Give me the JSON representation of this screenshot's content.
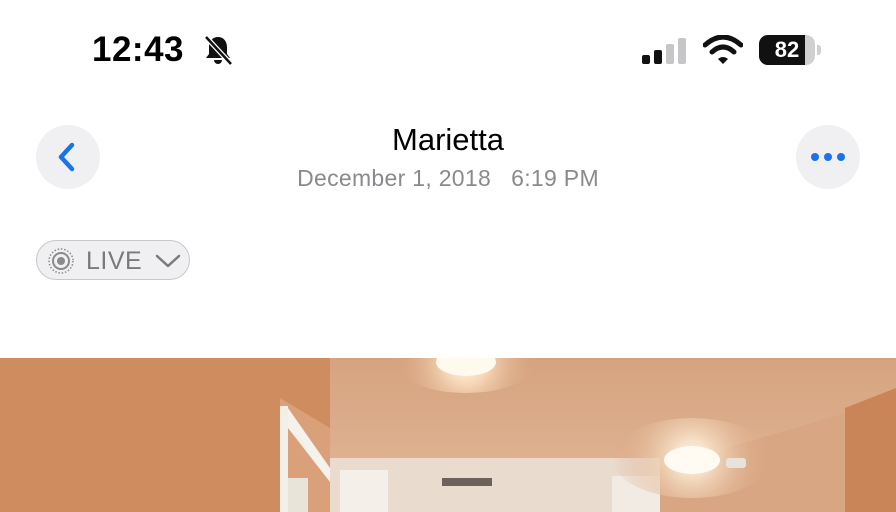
{
  "status": {
    "time": "12:43",
    "battery_level": "82",
    "icons": [
      "bell-slash-icon",
      "cellular-signal-icon",
      "wifi-icon",
      "battery-icon"
    ]
  },
  "nav": {
    "title": "Marietta",
    "subtitle": "December 1, 2018   6:19 PM",
    "back_icon": "chevron-left-icon",
    "more_icon": "ellipsis-icon"
  },
  "live": {
    "label": "LIVE",
    "icon": "live-photo-icon",
    "chevron": "chevron-down-icon"
  },
  "colors": {
    "accent": "#1a73e8",
    "secondary_text": "#8a8a8e",
    "button_bg": "#f0f0f2"
  },
  "photo": {
    "subject": "hallway-interior-photo"
  }
}
